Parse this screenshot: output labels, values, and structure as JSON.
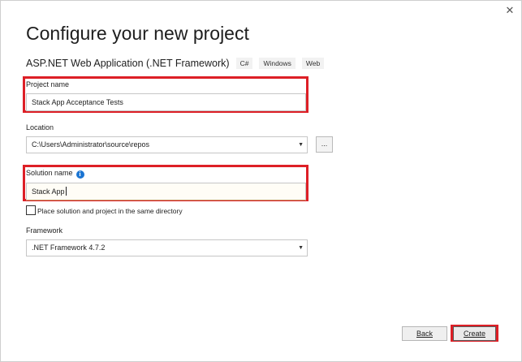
{
  "window": {
    "close_glyph": "✕"
  },
  "title": "Configure your new project",
  "template": {
    "name": "ASP.NET Web Application (.NET Framework)",
    "tags": [
      "C#",
      "Windows",
      "Web"
    ]
  },
  "project_name": {
    "label": "Project name",
    "value": "Stack App Acceptance Tests"
  },
  "location": {
    "label": "Location",
    "value": "C:\\Users\\Administrator\\source\\repos",
    "browse_label": "..."
  },
  "solution_name": {
    "label": "Solution name",
    "value": "Stack App",
    "info_icon": "info-icon"
  },
  "same_directory": {
    "label": "Place solution and project in the same directory",
    "checked": false
  },
  "framework": {
    "label": "Framework",
    "value": ".NET Framework 4.7.2"
  },
  "buttons": {
    "back": "Back",
    "create": "Create"
  },
  "colors": {
    "highlight": "#dd1f26",
    "info": "#1a74d2"
  }
}
